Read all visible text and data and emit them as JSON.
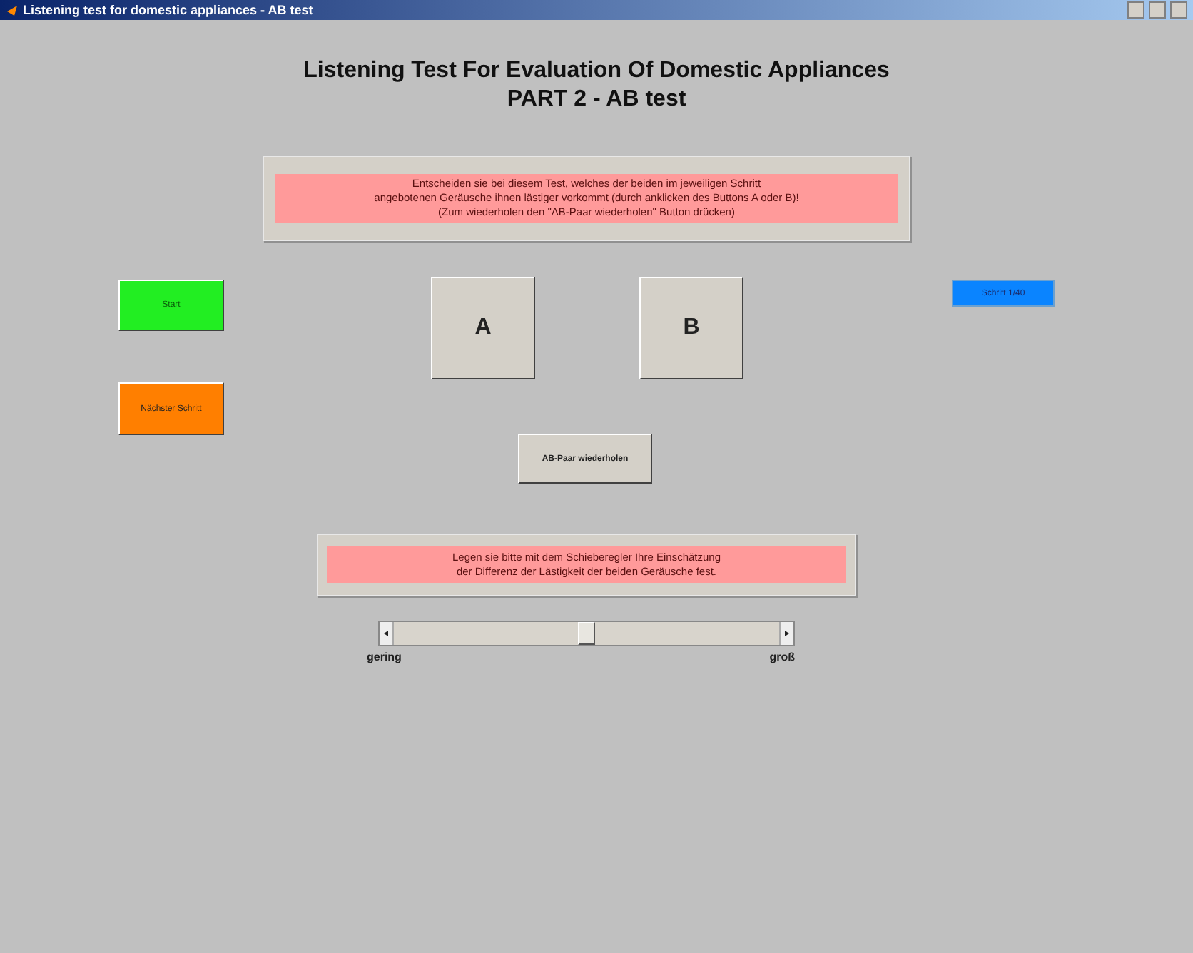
{
  "window": {
    "title": "Listening test for domestic appliances - AB test"
  },
  "heading": {
    "line1": "Listening Test For Evaluation Of Domestic Appliances",
    "line2": "PART 2 - AB test"
  },
  "instructions": [
    "Entscheiden sie bei diesem Test, welches der beiden im jeweiligen Schritt",
    "angebotenen Geräusche ihnen lästiger vorkommt (durch anklicken des Buttons A oder B)!",
    "(Zum wiederholen den \"AB-Paar wiederholen\" Button drücken)"
  ],
  "start_button": "Start",
  "next_button": "Nächster Schritt",
  "choice_buttons": [
    "A",
    "B"
  ],
  "step_indicator": "Schritt 1/40",
  "repeat_button": "AB-Paar wiederholen",
  "slider_instructions": [
    "Legen sie bitte mit dem Schieberegler Ihre Einschätzung",
    "der Differenz der Lästigkeit der beiden Geräusche fest."
  ],
  "slider": {
    "level": 0.5,
    "min_label": "gering",
    "max_label": "groß"
  }
}
